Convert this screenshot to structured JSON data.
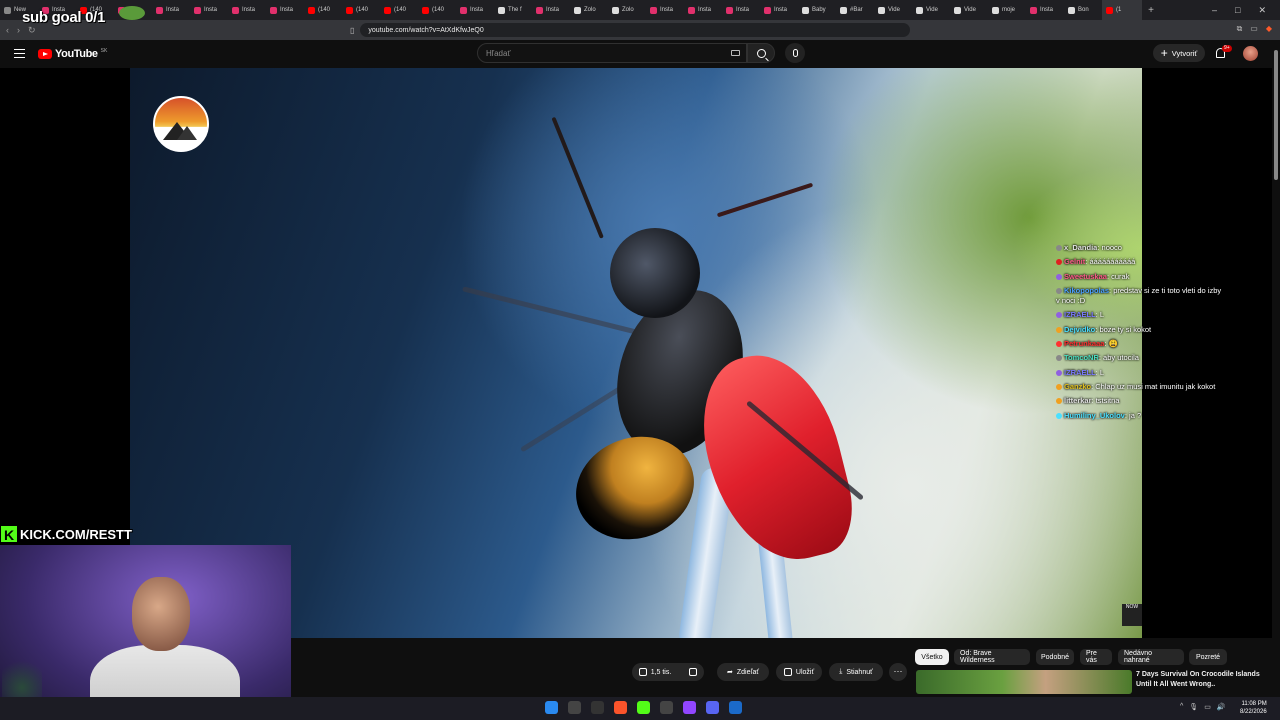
{
  "overlay": {
    "sub_goal": "sub goal 0/1",
    "kick_text": "KICK.COM/RESTT",
    "kick_letter": "K"
  },
  "browser": {
    "tabs": [
      {
        "label": "New",
        "color": "#888"
      },
      {
        "label": "Insta",
        "color": "#e1306c"
      },
      {
        "label": "(140",
        "color": "#ff0000"
      },
      {
        "label": "Insta",
        "color": "#e1306c"
      },
      {
        "label": "Insta",
        "color": "#e1306c"
      },
      {
        "label": "Insta",
        "color": "#e1306c"
      },
      {
        "label": "Insta",
        "color": "#e1306c"
      },
      {
        "label": "Insta",
        "color": "#e1306c"
      },
      {
        "label": "(140",
        "color": "#ff0000"
      },
      {
        "label": "(140",
        "color": "#ff0000"
      },
      {
        "label": "(140",
        "color": "#ff0000"
      },
      {
        "label": "(140",
        "color": "#ff0000"
      },
      {
        "label": "Insta",
        "color": "#e1306c"
      },
      {
        "label": "The f",
        "color": "#ddd"
      },
      {
        "label": "Insta",
        "color": "#e1306c"
      },
      {
        "label": "Zolo",
        "color": "#ddd"
      },
      {
        "label": "Zolo",
        "color": "#ddd"
      },
      {
        "label": "Insta",
        "color": "#e1306c"
      },
      {
        "label": "Insta",
        "color": "#e1306c"
      },
      {
        "label": "Insta",
        "color": "#e1306c"
      },
      {
        "label": "Insta",
        "color": "#e1306c"
      },
      {
        "label": "Baby",
        "color": "#ddd"
      },
      {
        "label": "#Bar",
        "color": "#ddd"
      },
      {
        "label": "Vide",
        "color": "#ddd"
      },
      {
        "label": "Vide",
        "color": "#ddd"
      },
      {
        "label": "Vide",
        "color": "#ddd"
      },
      {
        "label": "moje",
        "color": "#ddd"
      },
      {
        "label": "Insta",
        "color": "#e1306c"
      },
      {
        "label": "Bon",
        "color": "#ddd"
      },
      {
        "label": "(1",
        "color": "#ff0000",
        "active": true
      }
    ],
    "tab_add": "+",
    "url": "youtube.com/watch?v=AtXdKfwJeQ0"
  },
  "youtube": {
    "logo_text": "YouTube",
    "country_code": "SK",
    "search_placeholder": "Hľadať",
    "create_label": "Vytvoriť",
    "notif_badge": "9+"
  },
  "chat": [
    {
      "user": "x_Dandia",
      "text": "nooco",
      "color": "#e0e0e0",
      "dot": "#888"
    },
    {
      "user": "Gelnit",
      "text": "ááááááááááá",
      "color": "#ff5a8a",
      "dot": "#e02020"
    },
    {
      "user": "Sweetuskaa",
      "text": "curak",
      "color": "#ff5a8a",
      "dot": "#9060e0"
    },
    {
      "user": "Kikopopolas",
      "text": "predstav si ze ti toto vleti do izby v noci :D",
      "color": "#4aa0ff",
      "dot": "#888"
    },
    {
      "user": "IZRAELL",
      "text": "L",
      "color": "#7a7aff",
      "dot": "#9060e0"
    },
    {
      "user": "Dejvidko",
      "text": "boze ty si kokot",
      "color": "#4ae0ff",
      "dot": "#f0a020"
    },
    {
      "user": "Petrunkaaa",
      "text": "😩",
      "color": "#ff3030",
      "dot": "#ff3030"
    },
    {
      "user": "TomcoNR",
      "text": "aby utocila",
      "color": "#4ae0c0",
      "dot": "#888"
    },
    {
      "user": "IZRAELL",
      "text": "L",
      "color": "#7a7aff",
      "dot": "#9060e0"
    },
    {
      "user": "Ganzko",
      "text": "Chlap uz musi mat imunitu jak kokot",
      "color": "#e0c020",
      "dot": "#f0a020"
    },
    {
      "user": "litterkar",
      "text": "tstsitna",
      "color": "#e0e0e0",
      "dot": "#f0a020"
    },
    {
      "user": "Humiliny_Ukolov",
      "text": "ja ?",
      "color": "#4ae0ff",
      "dot": "#4ae0ff"
    }
  ],
  "video": {
    "now_badge": "NOW"
  },
  "actions": {
    "like_count": "1,5 tis.",
    "share": "Zdieľať",
    "save": "Uložiť",
    "download": "Stiahnuť",
    "more": "···"
  },
  "chips": [
    "Všetko",
    "Od: Brave Wilderness",
    "Podobné",
    "Pre vás",
    "Nedávno nahrané",
    "Pozreté"
  ],
  "recommended": {
    "title": "7 Days Survival On Crocodile Islands Until It All Went Wrong.."
  },
  "taskbar": {
    "time": "11:08 PM",
    "date": "8/22/2026"
  }
}
